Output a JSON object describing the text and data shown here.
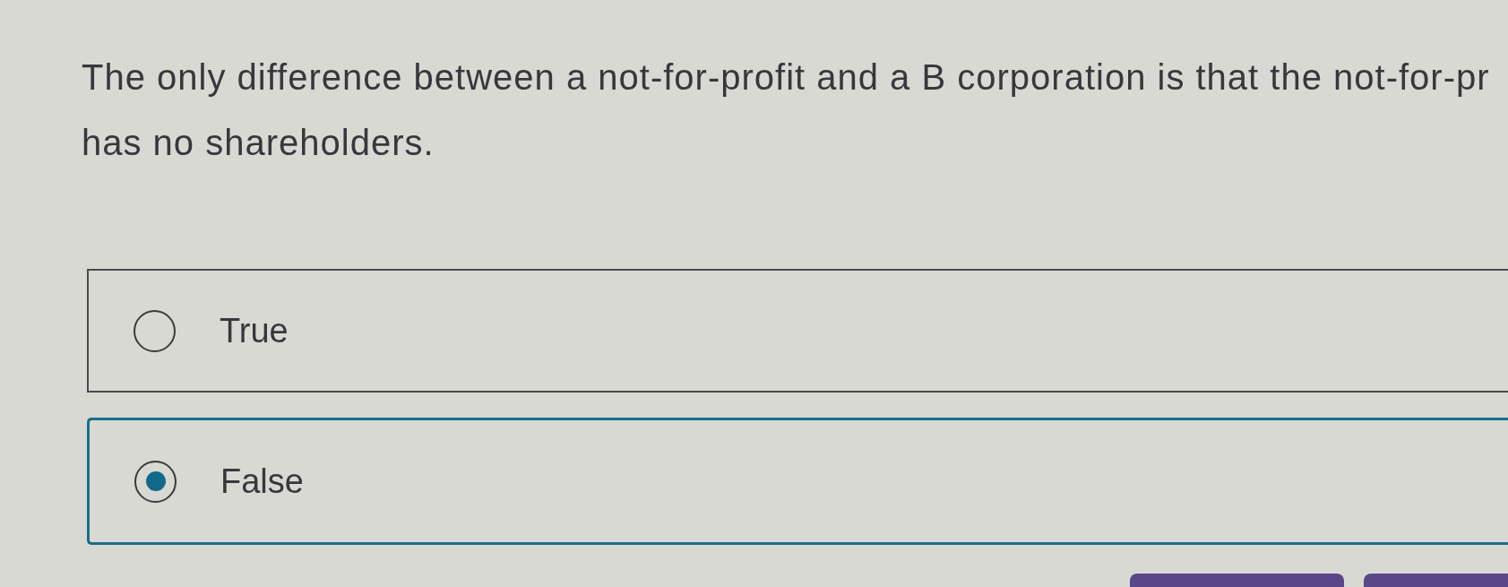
{
  "question": {
    "lines": [
      "The only difference between a not-for-profit and a B corporation is that the not-for-pr",
      "has no shareholders."
    ]
  },
  "options": [
    {
      "label": "True",
      "selected": false
    },
    {
      "label": "False",
      "selected": true
    }
  ],
  "action_buttons": [
    {
      "kind": "filled"
    },
    {
      "kind": "filled"
    }
  ]
}
